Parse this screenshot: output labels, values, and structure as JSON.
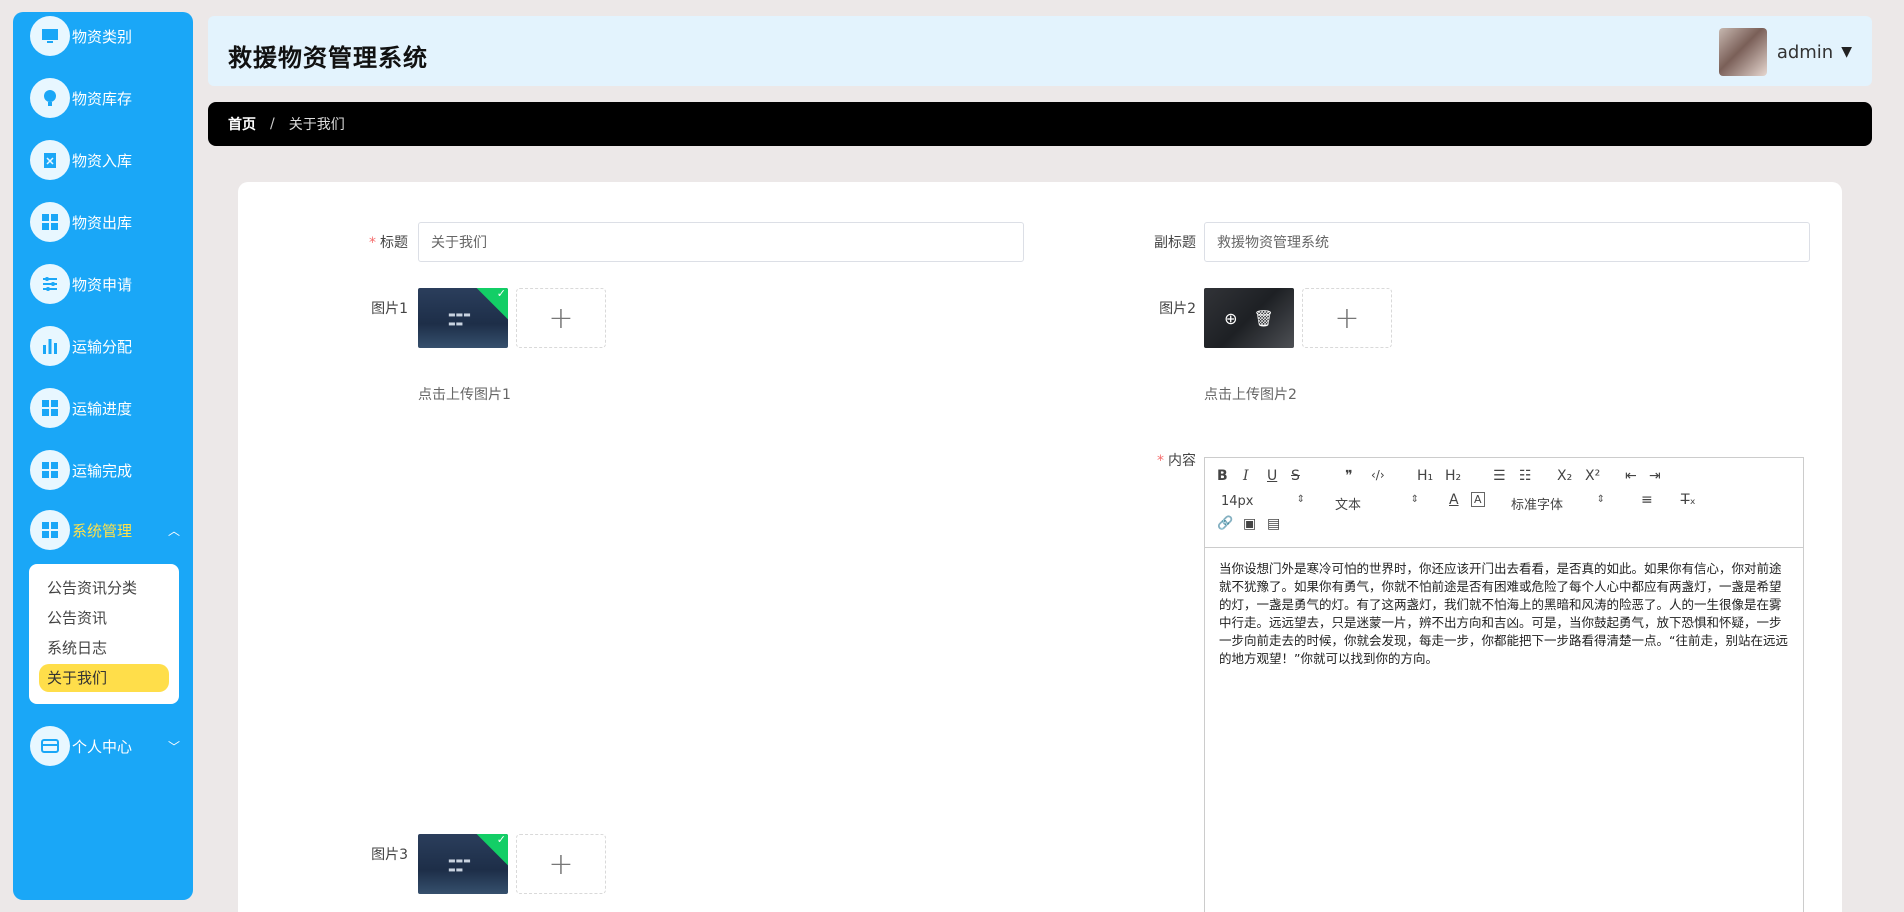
{
  "app": {
    "title": "救援物资管理系统"
  },
  "user": {
    "name": "admin"
  },
  "sidebar": {
    "items": [
      {
        "label": "物资类别",
        "icon": "monitor-icon"
      },
      {
        "label": "物资库存",
        "icon": "bulb-icon"
      },
      {
        "label": "物资入库",
        "icon": "clipboard-icon"
      },
      {
        "label": "物资出库",
        "icon": "grid-icon"
      },
      {
        "label": "物资申请",
        "icon": "sliders-icon"
      },
      {
        "label": "运输分配",
        "icon": "bar-chart-icon"
      },
      {
        "label": "运输进度",
        "icon": "grid-icon"
      },
      {
        "label": "运输完成",
        "icon": "grid-icon"
      },
      {
        "label": "系统管理",
        "icon": "grid-icon"
      },
      {
        "label": "个人中心",
        "icon": "card-icon"
      }
    ],
    "sub_items": [
      "公告资讯分类",
      "公告资讯",
      "系统日志",
      "关于我们"
    ]
  },
  "breadcrumb": {
    "home": "首页",
    "sep": "/",
    "current": "关于我们"
  },
  "form": {
    "title_label": "标题",
    "title_value": "关于我们",
    "subtitle_label": "副标题",
    "subtitle_value": "救援物资管理系统",
    "image1_label": "图片1",
    "image1_hint": "点击上传图片1",
    "image2_label": "图片2",
    "image2_hint": "点击上传图片2",
    "image3_label": "图片3",
    "content_label": "内容",
    "plus": "+",
    "required_mark": "*"
  },
  "editor": {
    "toolbar": {
      "bold": "B",
      "italic": "I",
      "underline": "U",
      "strike": "S",
      "quote": "❞",
      "code": "‹/›",
      "h1": "H₁",
      "h2": "H₂",
      "ordered_list": "☰",
      "bullet_list": "☷",
      "subscript": "X₂",
      "superscript": "X²",
      "outdent": "⇤",
      "indent": "⇥",
      "size": "14px",
      "text": "文本",
      "font": "标准字体",
      "color": "A",
      "background": "A",
      "align": "≡",
      "clear": "T̶ₓ",
      "link": "🔗",
      "image": "▣",
      "video": "▤"
    },
    "content": "当你设想门外是寒冷可怕的世界时，你还应该开门出去看看，是否真的如此。如果你有信心，你对前途就不犹豫了。如果你有勇气，你就不怕前途是否有困难或危险了每个人心中都应有两盏灯，一盏是希望的灯，一盏是勇气的灯。有了这两盏灯，我们就不怕海上的黑暗和风涛的险恶了。人的一生很像是在雾中行走。远远望去，只是迷蒙一片，辨不出方向和吉凶。可是，当你鼓起勇气，放下恐惧和怀疑，一步一步向前走去的时候，你就会发现，每走一步，你都能把下一步路看得清楚一点。“往前走，别站在远远的地方观望！”你就可以找到你的方向。"
  }
}
